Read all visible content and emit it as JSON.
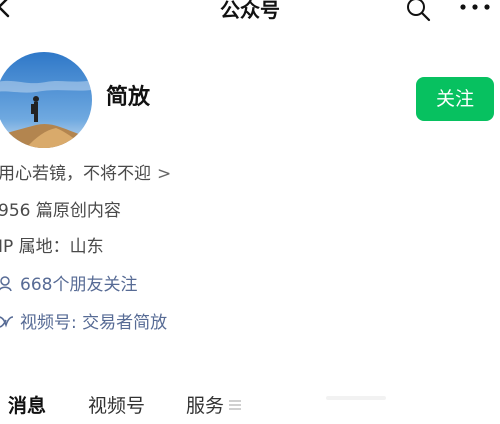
{
  "nav": {
    "title": "公众号",
    "icons": [
      "chevron-left-icon",
      "search-icon",
      "more-icon"
    ]
  },
  "profile": {
    "name": "简放",
    "follow_label": "关注",
    "bio": "用心若镜，不将不迎",
    "bio_arrow": ">",
    "article_count": "956 篇原创内容",
    "ip_location": "IP 属地：山东",
    "friends_following": "668个朋友关注",
    "channels": "视频号: 交易者简放"
  },
  "tabs": [
    {
      "label": "消息",
      "active": true
    },
    {
      "label": "视频号",
      "active": false
    },
    {
      "label": "服务",
      "active": false
    }
  ],
  "colors": {
    "accent": "#07c160",
    "link": "#576b95",
    "text": "#111111",
    "secondary_text": "#4a4a4a"
  }
}
